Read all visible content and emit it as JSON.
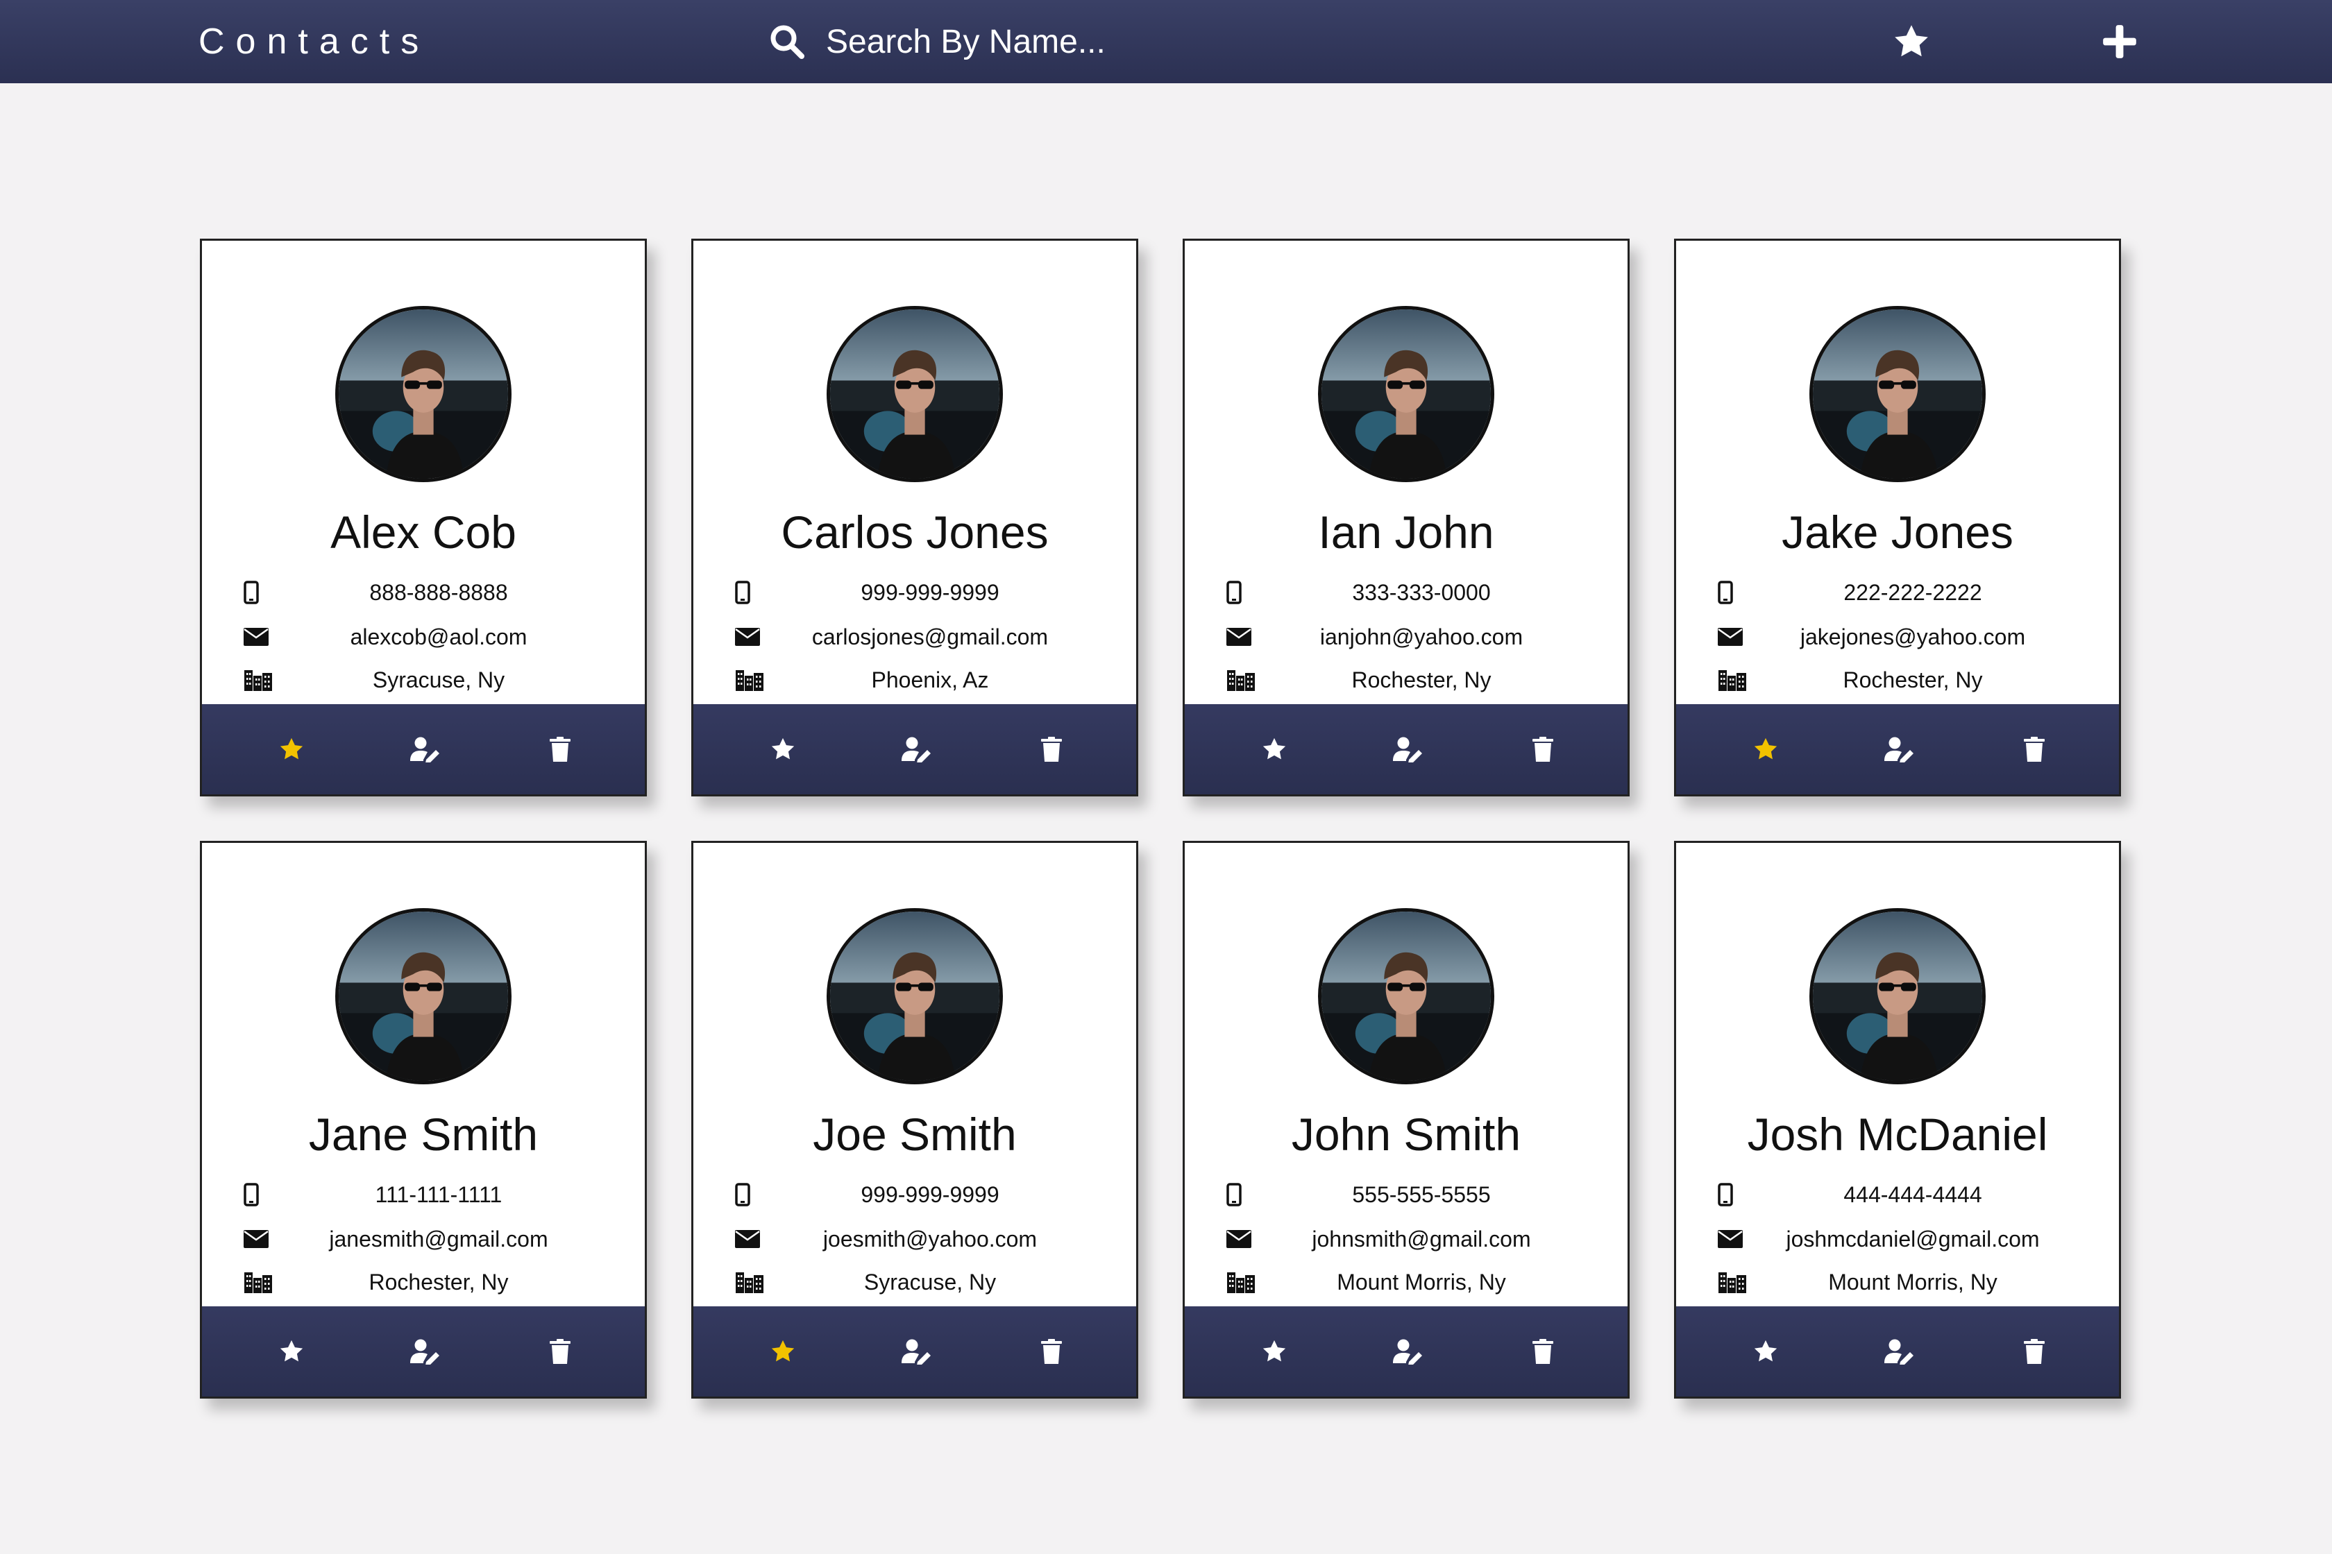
{
  "header": {
    "title": "Contacts",
    "search_placeholder": "Search By Name...",
    "search_icon": "search-icon",
    "favorites_icon": "star-icon",
    "add_icon": "plus-icon"
  },
  "colors": {
    "navbar": "#2f3456",
    "favorite_star": "#f2c200",
    "background": "#f3f2f3"
  },
  "contacts": [
    {
      "name": "Alex Cob",
      "phone": "888-888-8888",
      "email": "alexcob@aol.com",
      "location": "Syracuse, Ny",
      "favorite": true
    },
    {
      "name": "Carlos Jones",
      "phone": "999-999-9999",
      "email": "carlosjones@gmail.com",
      "location": "Phoenix, Az",
      "favorite": false
    },
    {
      "name": "Ian John",
      "phone": "333-333-0000",
      "email": "ianjohn@yahoo.com",
      "location": "Rochester, Ny",
      "favorite": false
    },
    {
      "name": "Jake Jones",
      "phone": "222-222-2222",
      "email": "jakejones@yahoo.com",
      "location": "Rochester, Ny",
      "favorite": true
    },
    {
      "name": "Jane Smith",
      "phone": "111-111-1111",
      "email": "janesmith@gmail.com",
      "location": "Rochester, Ny",
      "favorite": false
    },
    {
      "name": "Joe Smith",
      "phone": "999-999-9999",
      "email": "joesmith@yahoo.com",
      "location": "Syracuse, Ny",
      "favorite": true
    },
    {
      "name": "John Smith",
      "phone": "555-555-5555",
      "email": "johnsmith@gmail.com",
      "location": "Mount Morris, Ny",
      "favorite": false
    },
    {
      "name": "Josh McDaniel",
      "phone": "444-444-4444",
      "email": "joshmcdaniel@gmail.com",
      "location": "Mount Morris, Ny",
      "favorite": false
    }
  ]
}
